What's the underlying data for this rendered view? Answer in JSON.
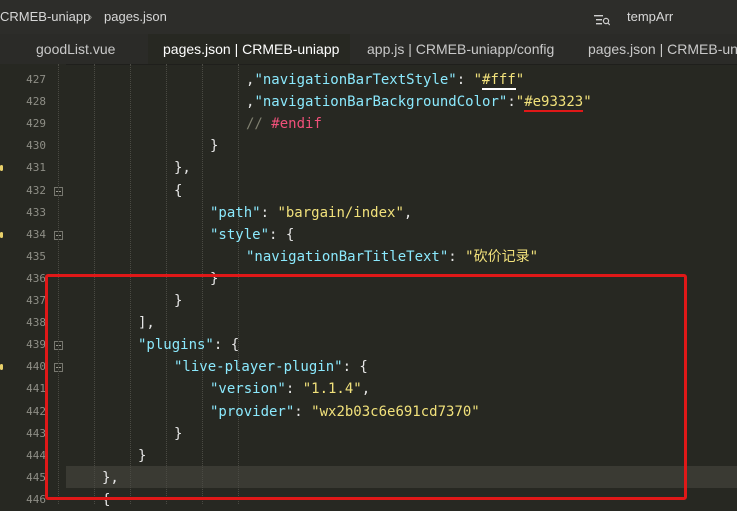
{
  "breadcrumb": {
    "project": "CRMEB-uniapp",
    "file": "pages.json",
    "symbol": "tempArr"
  },
  "tabs": [
    {
      "label": "goodList.vue"
    },
    {
      "label": "pages.json | CRMEB-uniapp"
    },
    {
      "label": "app.js | CRMEB-uniapp/config"
    },
    {
      "label": "pages.json | CRMEB-uniapp"
    }
  ],
  "editor": {
    "lines": [
      {
        "n": "427",
        "indent": 8,
        "tokens": [
          [
            "p",
            ","
          ],
          [
            "k",
            "\"navigationBarTextStyle\""
          ],
          [
            "p",
            ": "
          ],
          [
            "s",
            "\""
          ],
          [
            "su",
            "#fff"
          ],
          [
            "s",
            "\""
          ]
        ]
      },
      {
        "n": "428",
        "indent": 8,
        "tokens": [
          [
            "p",
            ","
          ],
          [
            "k",
            "\"navigationBarBackgroundColor\""
          ],
          [
            "p",
            ":"
          ],
          [
            "s",
            "\""
          ],
          [
            "sr",
            "#e93323"
          ],
          [
            "s",
            "\""
          ]
        ]
      },
      {
        "n": "429",
        "indent": 8,
        "tokens": [
          [
            "c",
            "// "
          ],
          [
            "m",
            "#endif"
          ]
        ]
      },
      {
        "n": "430",
        "indent": 7,
        "tokens": [
          [
            "p",
            "}"
          ]
        ]
      },
      {
        "n": "431",
        "indent": 6,
        "tokens": [
          [
            "p",
            "},"
          ]
        ]
      },
      {
        "n": "432",
        "indent": 6,
        "tokens": [
          [
            "p",
            "{"
          ]
        ]
      },
      {
        "n": "433",
        "indent": 7,
        "tokens": [
          [
            "k",
            "\"path\""
          ],
          [
            "p",
            ": "
          ],
          [
            "s",
            "\"bargain/index\""
          ],
          [
            "p",
            ","
          ]
        ]
      },
      {
        "n": "434",
        "indent": 7,
        "tokens": [
          [
            "k",
            "\"style\""
          ],
          [
            "p",
            ": {"
          ]
        ]
      },
      {
        "n": "435",
        "indent": 8,
        "tokens": [
          [
            "k",
            "\"navigationBarTitleText\""
          ],
          [
            "p",
            ": "
          ],
          [
            "s",
            "\"砍价记录\""
          ]
        ]
      },
      {
        "n": "436",
        "indent": 7,
        "tokens": [
          [
            "p",
            "}"
          ]
        ]
      },
      {
        "n": "437",
        "indent": 6,
        "tokens": [
          [
            "p",
            "}"
          ]
        ]
      },
      {
        "n": "438",
        "indent": 5,
        "tokens": [
          [
            "p",
            "],"
          ]
        ]
      },
      {
        "n": "439",
        "indent": 5,
        "tokens": [
          [
            "k",
            "\"plugins\""
          ],
          [
            "p",
            ": {"
          ]
        ]
      },
      {
        "n": "440",
        "indent": 6,
        "tokens": [
          [
            "k",
            "\"live-player-plugin\""
          ],
          [
            "p",
            ": {"
          ]
        ]
      },
      {
        "n": "441",
        "indent": 7,
        "tokens": [
          [
            "k",
            "\"version\""
          ],
          [
            "p",
            ": "
          ],
          [
            "s",
            "\"1.1.4\""
          ],
          [
            "p",
            ","
          ]
        ]
      },
      {
        "n": "442",
        "indent": 7,
        "tokens": [
          [
            "k",
            "\"provider\""
          ],
          [
            "p",
            ": "
          ],
          [
            "s",
            "\"wx2b03c6e691cd7370\""
          ]
        ]
      },
      {
        "n": "443",
        "indent": 6,
        "tokens": [
          [
            "p",
            "}"
          ]
        ]
      },
      {
        "n": "444",
        "indent": 5,
        "tokens": [
          [
            "p",
            "}"
          ]
        ]
      },
      {
        "n": "445",
        "indent": 4,
        "tokens": [
          [
            "p",
            "},"
          ]
        ]
      },
      {
        "n": "446",
        "indent": 4,
        "tokens": [
          [
            "p",
            "{"
          ]
        ]
      }
    ]
  }
}
